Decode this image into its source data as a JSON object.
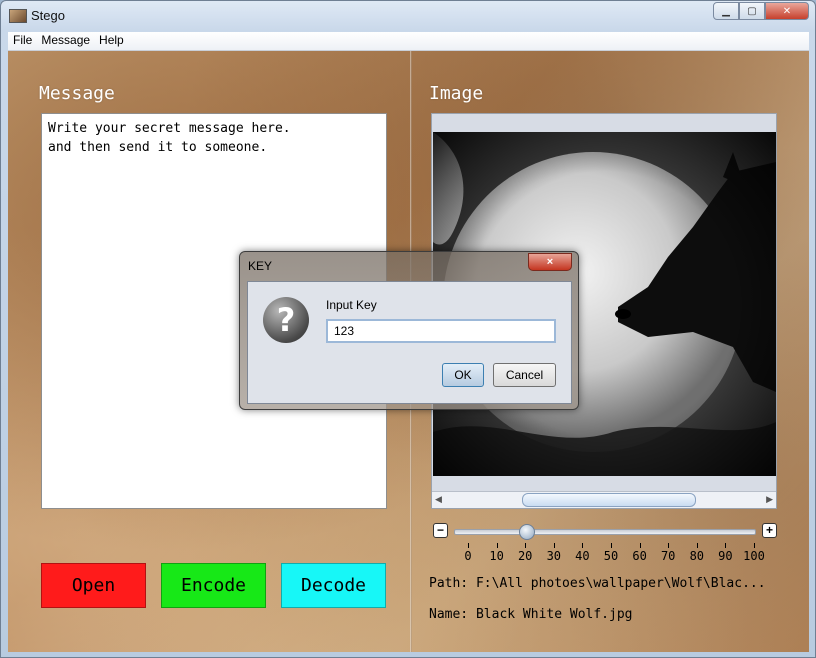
{
  "window": {
    "title": "Stego"
  },
  "menu": {
    "items": [
      "File",
      "Message",
      "Help"
    ]
  },
  "message_panel": {
    "title": "Message",
    "text": "Write your secret message here.\nand then send it to someone."
  },
  "buttons": {
    "open": "Open",
    "encode": "Encode",
    "decode": "Decode"
  },
  "image_panel": {
    "title": "Image",
    "path": "Path: F:\\All photoes\\wallpaper\\Wolf\\Blac...",
    "name": "Name: Black White Wolf.jpg"
  },
  "zoom": {
    "minus": "−",
    "plus": "+",
    "value": 20,
    "min": 0,
    "max": 100,
    "ticks": [
      "0",
      "10",
      "20",
      "30",
      "40",
      "50",
      "60",
      "70",
      "80",
      "90",
      "100"
    ]
  },
  "dialog": {
    "title": "KEY",
    "label": "Input Key",
    "value": "123",
    "ok": "OK",
    "cancel": "Cancel",
    "close": "×"
  },
  "colors": {
    "open": "#ff1b1b",
    "encode": "#17e817",
    "decode": "#17f7f7"
  },
  "icons": {
    "dialog": "question-icon",
    "close": "close-icon"
  }
}
